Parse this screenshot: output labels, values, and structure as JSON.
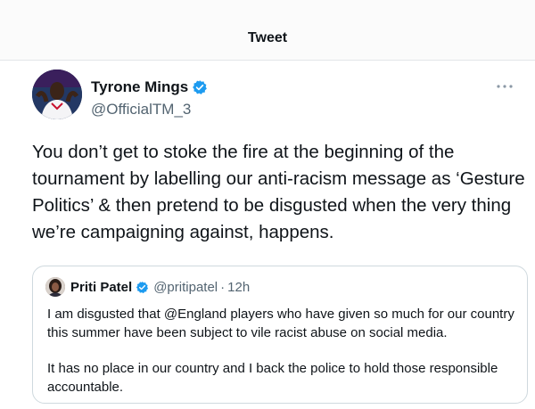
{
  "header": {
    "title": "Tweet"
  },
  "author": {
    "name": "Tyrone Mings",
    "handle": "@OfficialTM_3",
    "verified": true
  },
  "tweet": {
    "text": "You don’t get to stoke the fire at the beginning of the\ntournament by labelling our anti-racism message as ‘Gesture\nPolitics’ & then pretend to be disgusted when the very thing\nwe’re campaigning against, happens."
  },
  "quoted_tweet": {
    "name": "Priti Patel",
    "handle": "@pritipatel",
    "separator": "·",
    "time": "12h",
    "verified": true,
    "paragraphs": [
      "I am disgusted that @England players who have given so much for our country this summer have been subject to vile racist abuse on social media.",
      "It has no place in our country and I back the police to hold those responsible accountable."
    ]
  },
  "colors": {
    "verified_blue": "#1d9bf0",
    "secondary_text": "#536471",
    "border": "#cfd9de"
  },
  "icons": {
    "verified": "verified-badge-icon",
    "more": "more-dots-icon"
  }
}
